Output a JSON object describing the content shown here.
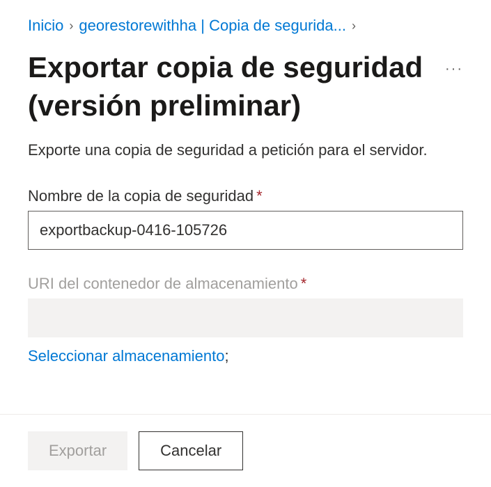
{
  "breadcrumb": {
    "home": "Inicio",
    "second": "georestorewithha | Copia de segurida..."
  },
  "title": "Exportar copia de seguridad (versión preliminar)",
  "description": "Exporte una copia de seguridad a petición para el servidor.",
  "fields": {
    "backupName": {
      "label": "Nombre de la copia de seguridad",
      "value": "exportbackup-0416-105726"
    },
    "storageUri": {
      "label": "URI del contenedor de almacenamiento",
      "value": ""
    },
    "selectStorageLink": "Seleccionar almacenamiento",
    "selectStorageSuffix": ";"
  },
  "buttons": {
    "export": "Exportar",
    "cancel": "Cancelar"
  }
}
